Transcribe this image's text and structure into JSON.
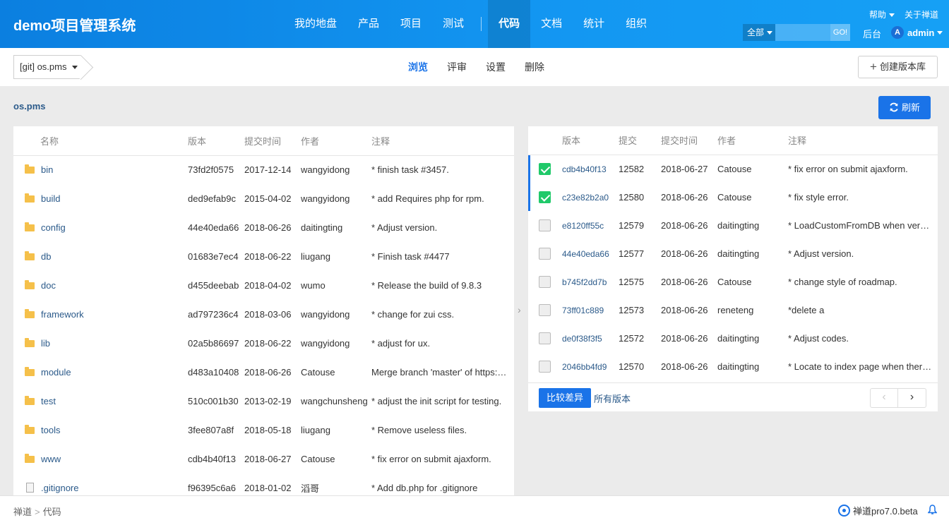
{
  "brand": "demo项目管理系统",
  "main_nav": [
    "我的地盘",
    "产品",
    "项目",
    "测试",
    "代码",
    "文档",
    "统计",
    "组织"
  ],
  "active_nav": "代码",
  "top_links": {
    "help": "帮助",
    "about": "关于禅道"
  },
  "search": {
    "scope": "全部",
    "go": "GO!"
  },
  "admin_link": "后台",
  "user": {
    "avatar": "A",
    "name": "admin"
  },
  "repo_select": "[git] os.pms",
  "sub_nav": [
    "浏览",
    "评审",
    "设置",
    "删除"
  ],
  "create_repo": "创建版本库",
  "path": "os.pms",
  "refresh": "刷新",
  "files": {
    "headers": [
      "名称",
      "版本",
      "提交时间",
      "作者",
      "注释"
    ],
    "rows": [
      {
        "name": "bin",
        "type": "folder",
        "rev": "73fd2f0575",
        "date": "2017-12-14",
        "author": "wangyidong",
        "comment": "* finish task #3457."
      },
      {
        "name": "build",
        "type": "folder",
        "rev": "ded9efab9c",
        "date": "2015-04-02",
        "author": "wangyidong",
        "comment": "* add Requires php for rpm."
      },
      {
        "name": "config",
        "type": "folder",
        "rev": "44e40eda66",
        "date": "2018-06-26",
        "author": "daitingting",
        "comment": "* Adjust version."
      },
      {
        "name": "db",
        "type": "folder",
        "rev": "01683e7ec4",
        "date": "2018-06-22",
        "author": "liugang",
        "comment": "* Finish task #4477"
      },
      {
        "name": "doc",
        "type": "folder",
        "rev": "d455deebab",
        "date": "2018-04-02",
        "author": "wumo",
        "comment": "* Release the build of 9.8.3"
      },
      {
        "name": "framework",
        "type": "folder",
        "rev": "ad797236c4",
        "date": "2018-03-06",
        "author": "wangyidong",
        "comment": "* change for zui css."
      },
      {
        "name": "lib",
        "type": "folder",
        "rev": "02a5b86697",
        "date": "2018-06-22",
        "author": "wangyidong",
        "comment": "* adjust for ux."
      },
      {
        "name": "module",
        "type": "folder",
        "rev": "d483a10408",
        "date": "2018-06-26",
        "author": "Catouse",
        "comment": "Merge branch 'master' of https:…"
      },
      {
        "name": "test",
        "type": "folder",
        "rev": "510c001b30",
        "date": "2013-02-19",
        "author": "wangchunsheng",
        "comment": "* adjust the init script for testing."
      },
      {
        "name": "tools",
        "type": "folder",
        "rev": "3fee807a8f",
        "date": "2018-05-18",
        "author": "liugang",
        "comment": "* Remove useless files."
      },
      {
        "name": "www",
        "type": "folder",
        "rev": "cdb4b40f13",
        "date": "2018-06-27",
        "author": "Catouse",
        "comment": "* fix error on submit ajaxform."
      },
      {
        "name": ".gitignore",
        "type": "file",
        "rev": "f96395c6a6",
        "date": "2018-01-02",
        "author": "滔哥",
        "comment": "* Add db.php for .gitignore"
      }
    ]
  },
  "revisions": {
    "headers": [
      "版本",
      "提交",
      "提交时间",
      "作者",
      "注释"
    ],
    "rows": [
      {
        "checked": true,
        "rev": "cdb4b40f13",
        "commit": "12582",
        "date": "2018-06-27",
        "author": "Catouse",
        "comment": "* fix error on submit ajaxform."
      },
      {
        "checked": true,
        "rev": "c23e82b2a0",
        "commit": "12580",
        "date": "2018-06-26",
        "author": "Catouse",
        "comment": "* fix style error."
      },
      {
        "checked": false,
        "rev": "e8120ff55c",
        "commit": "12579",
        "date": "2018-06-26",
        "author": "daitingting",
        "comment": "* LoadCustomFromDB when ver…"
      },
      {
        "checked": false,
        "rev": "44e40eda66",
        "commit": "12577",
        "date": "2018-06-26",
        "author": "daitingting",
        "comment": "* Adjust version."
      },
      {
        "checked": false,
        "rev": "b745f2dd7b",
        "commit": "12575",
        "date": "2018-06-26",
        "author": "Catouse",
        "comment": "* change style of roadmap."
      },
      {
        "checked": false,
        "rev": "73ff01c889",
        "commit": "12573",
        "date": "2018-06-26",
        "author": "reneteng",
        "comment": "*delete a"
      },
      {
        "checked": false,
        "rev": "de0f38f3f5",
        "commit": "12572",
        "date": "2018-06-26",
        "author": "daitingting",
        "comment": "* Adjust codes."
      },
      {
        "checked": false,
        "rev": "2046bb4fd9",
        "commit": "12570",
        "date": "2018-06-26",
        "author": "daitingting",
        "comment": "* Locate to index page when ther…"
      }
    ],
    "compare": "比较差异",
    "all_revisions": "所有版本",
    "pager": {
      "prev": "‹",
      "next": "›"
    }
  },
  "breadcrumb": [
    "禅道",
    "代码"
  ],
  "version": "禅道pro7.0.beta"
}
